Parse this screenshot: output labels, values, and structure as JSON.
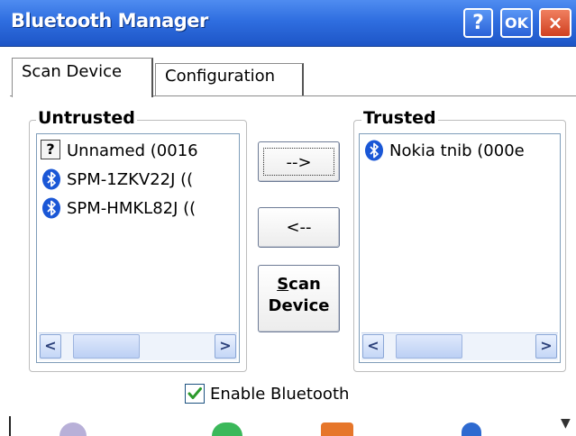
{
  "window": {
    "title": "Bluetooth Manager",
    "help_button": "?",
    "ok_button": "OK",
    "close_button": "×"
  },
  "tabs": [
    {
      "label": "Scan Device",
      "active": true
    },
    {
      "label": "Configuration",
      "active": false
    }
  ],
  "untrusted": {
    "label": "Untrusted",
    "items": [
      {
        "icon": "unknown-device-icon",
        "text": "Unnamed (0016"
      },
      {
        "icon": "bluetooth-icon",
        "text": "SPM-1ZKV22J (("
      },
      {
        "icon": "bluetooth-icon",
        "text": "SPM-HMKL82J (("
      }
    ]
  },
  "trusted": {
    "label": "Trusted",
    "items": [
      {
        "icon": "bluetooth-icon",
        "text": "Nokia tnib (000e"
      }
    ]
  },
  "buttons": {
    "move_to_trusted": "-->",
    "move_to_untrusted": "<--",
    "scan_line1_accel": "S",
    "scan_line1_rest": "can",
    "scan_line2": "Device"
  },
  "scroll": {
    "left_arrow": "<",
    "right_arrow": ">"
  },
  "enable_bluetooth": {
    "label": "Enable Bluetooth",
    "checked": true
  },
  "colors": {
    "titlebar": "#2f6ee0",
    "bluetooth_icon": "#1a57d6",
    "check": "#2c9a2c"
  }
}
